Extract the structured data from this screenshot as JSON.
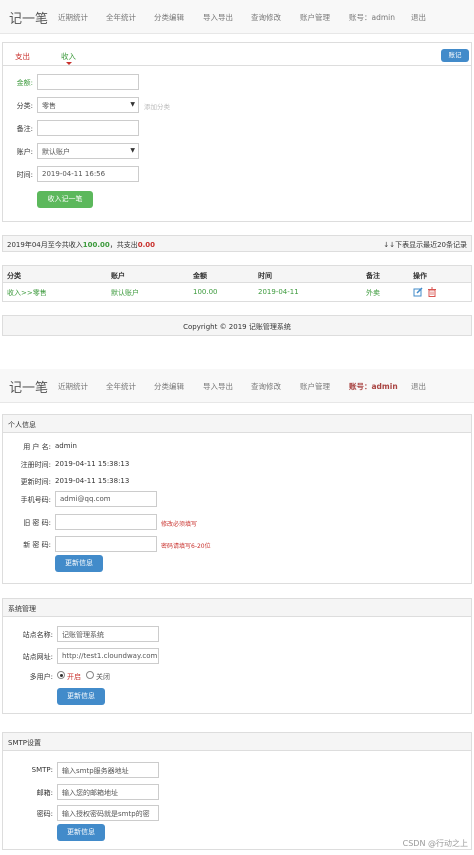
{
  "nav1": {
    "brand": "记一笔",
    "items": [
      "近期统计",
      "全年统计",
      "分类编辑",
      "导入导出",
      "查询修改",
      "账户管理"
    ],
    "account": "账号：admin",
    "logout": "退出"
  },
  "tabs": {
    "expense": "支出",
    "income": "收入",
    "rightButton": "账记"
  },
  "form": {
    "amount_label": "金额:",
    "amount_value": "",
    "category_label": "分类:",
    "category_value": "零售",
    "add_category": "添加分类",
    "note_label": "备注:",
    "note_value": "",
    "account_label": "账户:",
    "account_value": "默认账户",
    "time_label": "时间:",
    "time_value": "2019-04-11 16:56",
    "submit": "收入记一笔"
  },
  "summary": {
    "prefix": "2019年04月至今共收入",
    "income": "100.00",
    "mid": "，共支出",
    "expense": "0.00",
    "right": "↓↓下表显示最近20条记录"
  },
  "table": {
    "headers": [
      "分类",
      "账户",
      "金额",
      "时间",
      "备注",
      "操作"
    ],
    "rows": [
      {
        "category": "收入>>零售",
        "account": "默认账户",
        "amount": "100.00",
        "time": "2019-04-11",
        "note": "外卖"
      }
    ]
  },
  "footer": "Copyright © 2019 记账管理系统",
  "nav2": {
    "brand": "记一笔",
    "items": [
      "近期统计",
      "全年统计",
      "分类编辑",
      "导入导出",
      "查询修改",
      "账户管理"
    ],
    "account": "账号：admin",
    "logout": "退出"
  },
  "personal": {
    "title": "个人信息",
    "username_label": "用 户 名:",
    "username_value": "admin",
    "reg_label": "注册时间:",
    "reg_value": "2019-04-11 15:38:13",
    "upd_label": "更新时间:",
    "upd_value": "2019-04-11 15:38:13",
    "phone_label": "手机号码:",
    "phone_value": "admi@qq.com",
    "oldpw_label": "旧 密 码:",
    "oldpw_hint": "修改必须填写",
    "newpw_label": "新 密 码:",
    "newpw_hint": "密码请填写6-20位",
    "update": "更新信息"
  },
  "system": {
    "title": "系统管理",
    "site_name_label": "站点名称:",
    "site_name_value": "记账管理系统",
    "site_url_label": "站点网址:",
    "site_url_value": "http://test1.cloundway.com",
    "multi_label": "多用户:",
    "on": "开启",
    "off": "关闭",
    "update": "更新信息"
  },
  "smtp": {
    "title": "SMTP设置",
    "smtp_label": "SMTP:",
    "smtp_placeholder": "输入smtp服务器地址",
    "mail_label": "邮箱:",
    "mail_placeholder": "输入您的邮箱地址",
    "pw_label": "密码:",
    "pw_placeholder": "输入授权密码就是smtp的密",
    "update": "更新信息"
  },
  "watermark": "CSDN @行动之上",
  "colors": {
    "green": "#5cb85c",
    "blue": "#428bca",
    "red": "#c9302c",
    "navbg": "#f8f8f8"
  }
}
